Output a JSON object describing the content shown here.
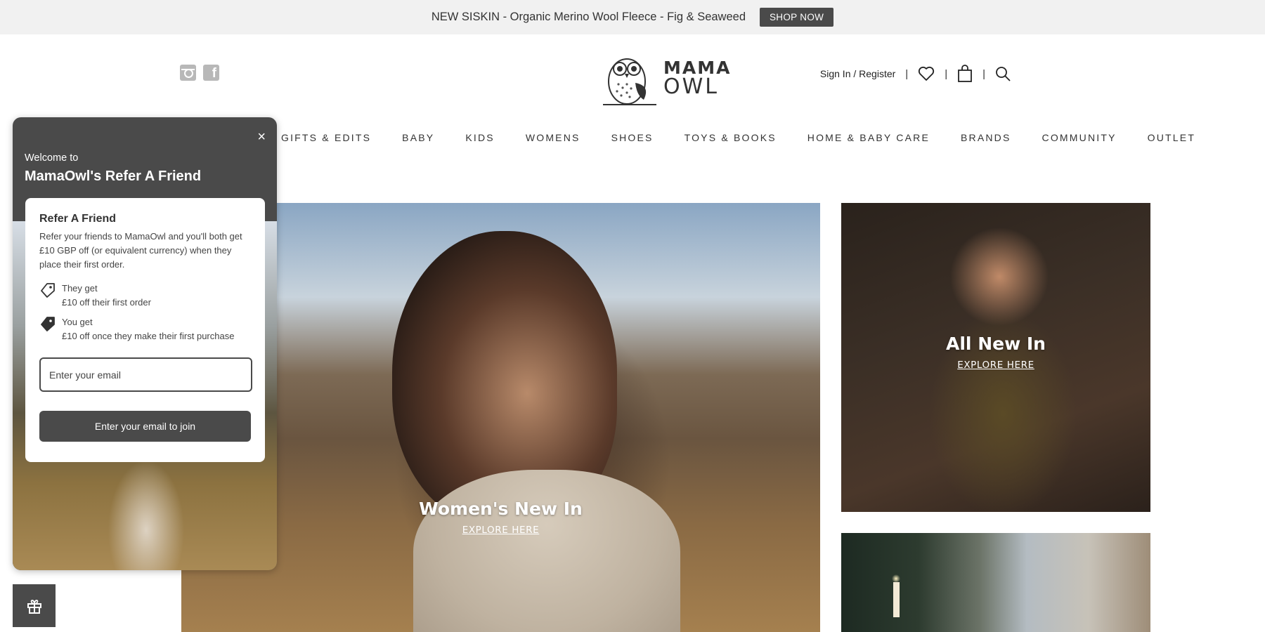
{
  "announcement": {
    "text": "NEW SISKIN - Organic Merino Wool Fleece - Fig & Seaweed",
    "button": "SHOP NOW"
  },
  "social": {
    "icons": [
      "instagram-icon",
      "facebook-icon"
    ],
    "facebook_glyph": "f"
  },
  "logo": {
    "line1": "MAMA",
    "line2": "OWL"
  },
  "account": {
    "sign_in": "Sign In / Register",
    "separator": "|",
    "icons": [
      "heart-icon",
      "bag-icon",
      "search-icon"
    ]
  },
  "nav": {
    "items": [
      "GIFTS & EDITS",
      "BABY",
      "KIDS",
      "WOMENS",
      "SHOES",
      "TOYS & BOOKS",
      "HOME & BABY CARE",
      "BRANDS",
      "COMMUNITY",
      "OUTLET"
    ]
  },
  "tiles": {
    "main": {
      "title": "Women's New In",
      "link": "EXPLORE HERE"
    },
    "right_top": {
      "title": "All New In",
      "link": "EXPLORE HERE"
    }
  },
  "refer_popup": {
    "close": "×",
    "welcome": "Welcome to",
    "title": "MamaOwl's Refer A Friend",
    "card_heading": "Refer A Friend",
    "card_description": "Refer your friends to MamaOwl and you'll both get £10 GBP off (or equivalent currency) when they place their first order.",
    "they_get_title": "They get",
    "they_get_detail": "£10 off their first order",
    "you_get_title": "You get",
    "you_get_detail": "£10 off once they make their first purchase",
    "email_placeholder": "Enter your email",
    "join_button": "Enter your email to join"
  },
  "colors": {
    "accent": "#4a4a4a",
    "announce_bg": "#f1f1f1"
  }
}
